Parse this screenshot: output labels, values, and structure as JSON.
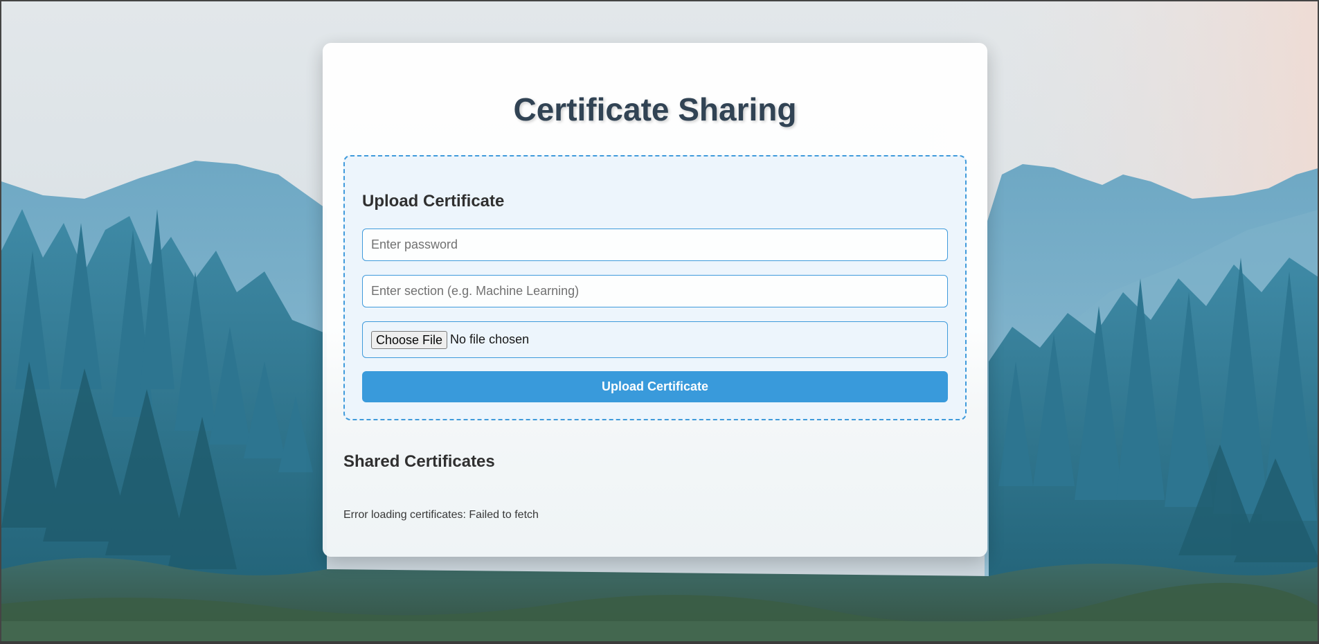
{
  "page": {
    "title": "Certificate Sharing"
  },
  "upload": {
    "heading": "Upload Certificate",
    "password_placeholder": "Enter password",
    "password_value": "",
    "section_placeholder": "Enter section (e.g. Machine Learning)",
    "section_value": "",
    "choose_file_label": "Choose File",
    "file_status": "No file chosen",
    "submit_label": "Upload Certificate"
  },
  "shared": {
    "heading": "Shared Certificates",
    "error": "Error loading certificates: Failed to fetch"
  },
  "colors": {
    "accent": "#3498db",
    "title": "#2c3e50",
    "upload_bg": "#eef6fd"
  },
  "background": {
    "icon": "forest-mountain-landscape"
  }
}
